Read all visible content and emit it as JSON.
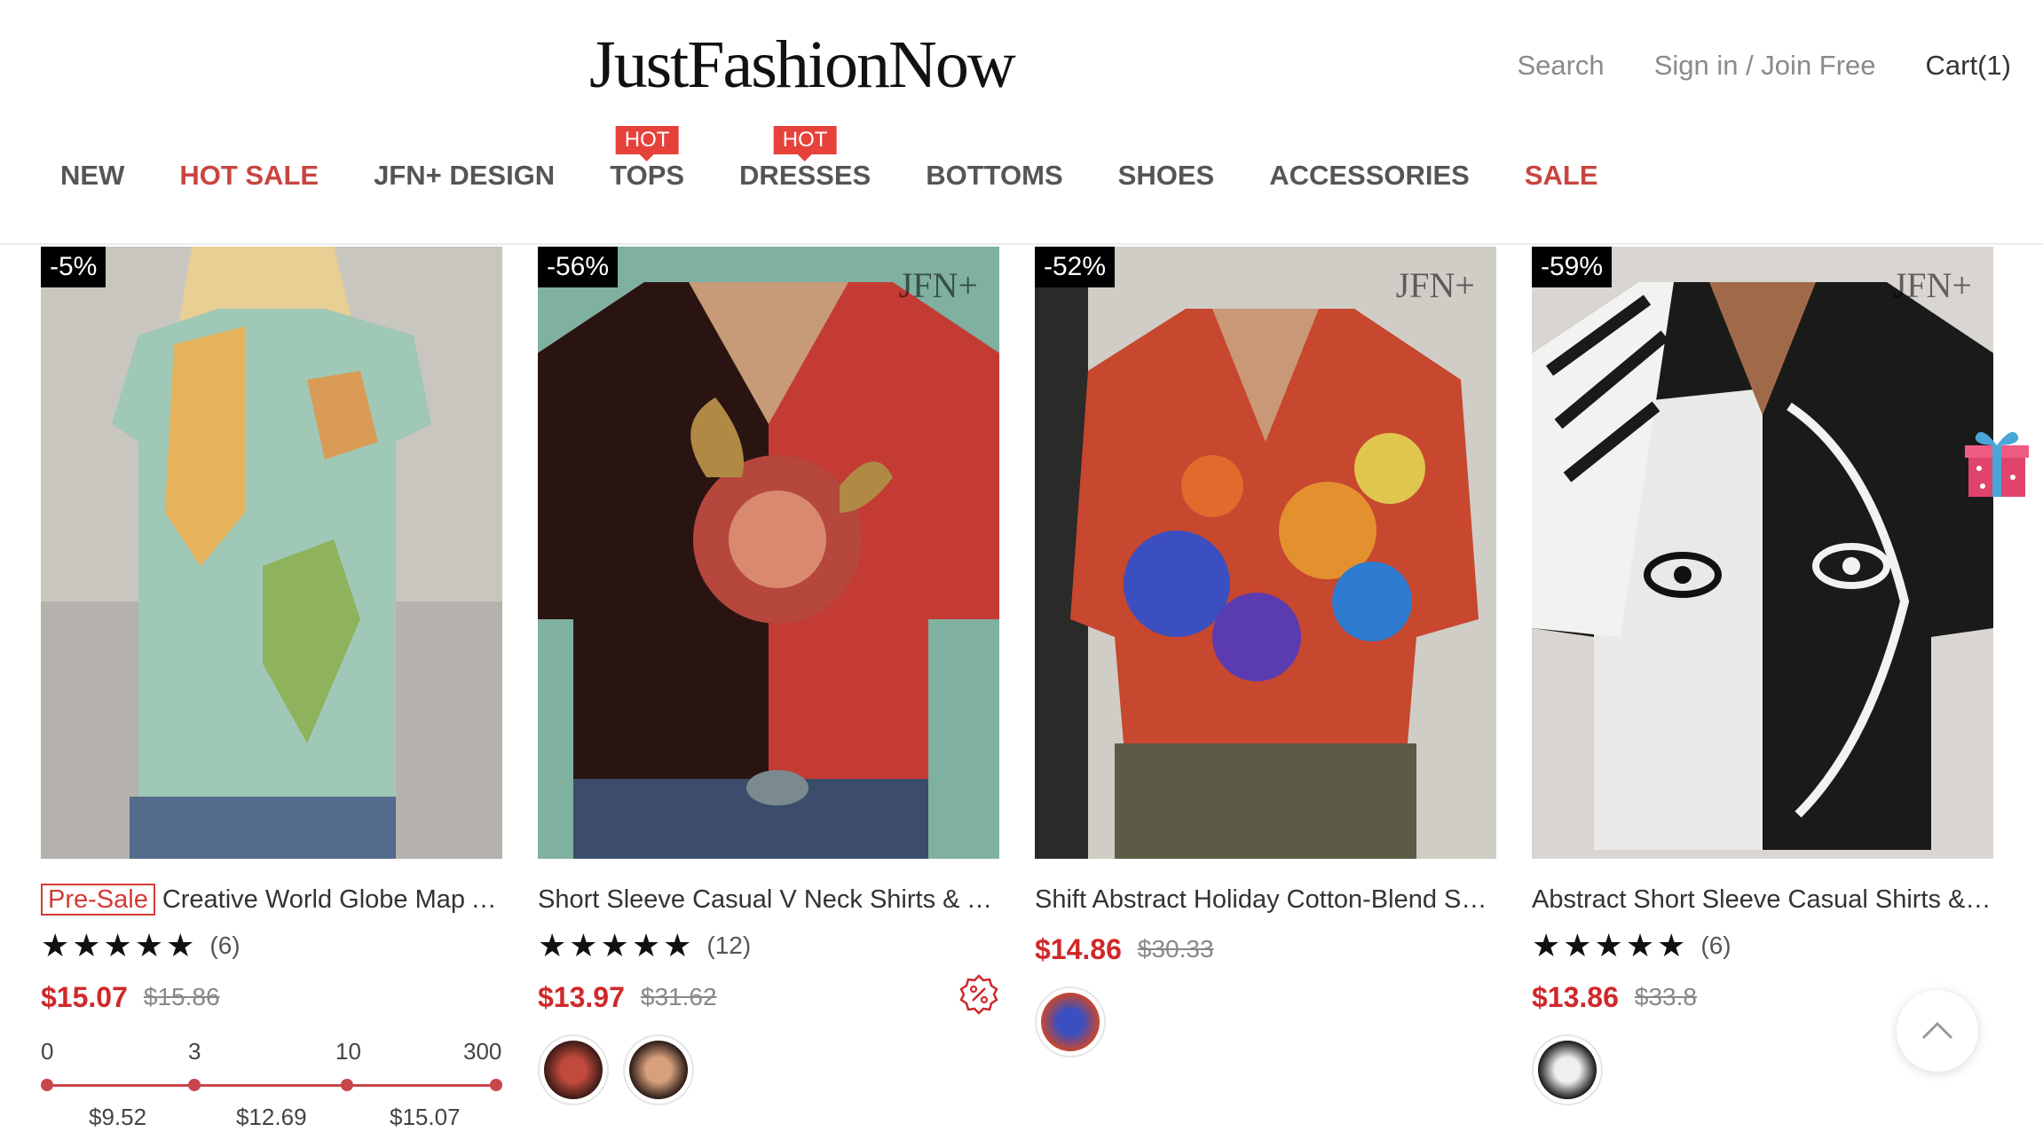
{
  "header": {
    "logo": "JustFashionNow",
    "search": "Search",
    "signin": "Sign in / Join Free",
    "cart": "Cart(1)"
  },
  "nav": [
    {
      "label": "NEW",
      "red": false,
      "hot": ""
    },
    {
      "label": "HOT SALE",
      "red": true,
      "hot": ""
    },
    {
      "label": "JFN+ DESIGN",
      "red": false,
      "hot": ""
    },
    {
      "label": "TOPS",
      "red": false,
      "hot": "HOT"
    },
    {
      "label": "DRESSES",
      "red": false,
      "hot": "HOT"
    },
    {
      "label": "BOTTOMS",
      "red": false,
      "hot": ""
    },
    {
      "label": "SHOES",
      "red": false,
      "hot": ""
    },
    {
      "label": "ACCESSORIES",
      "red": false,
      "hot": ""
    },
    {
      "label": "SALE",
      "red": true,
      "hot": ""
    }
  ],
  "products": [
    {
      "discount": "-5%",
      "jfn_mark": "",
      "presale": "Pre-Sale",
      "title": "Creative World Globe Map A...",
      "stars": "★★★★★",
      "reviews": "(6)",
      "price": "$15.07",
      "old_price": "$15.86",
      "tiers": {
        "qty": [
          "0",
          "3",
          "10",
          "300"
        ],
        "prices": [
          "$9.52",
          "$12.69",
          "$15.07"
        ]
      }
    },
    {
      "discount": "-56%",
      "jfn_mark": "JFN+",
      "presale": "",
      "title": "Short Sleeve Casual V Neck Shirts & Tops",
      "stars": "★★★★★",
      "reviews": "(12)",
      "price": "$13.97",
      "old_price": "$31.62"
    },
    {
      "discount": "-52%",
      "jfn_mark": "JFN+",
      "presale": "",
      "title": "Shift Abstract Holiday Cotton-Blend Shirt...",
      "stars": "",
      "reviews": "",
      "price": "$14.86",
      "old_price": "$30.33"
    },
    {
      "discount": "-59%",
      "jfn_mark": "JFN+",
      "presale": "",
      "title": "Abstract Short Sleeve Casual Shirts & Tops",
      "stars": "★★★★★",
      "reviews": "(6)",
      "price": "$13.86",
      "old_price": "$33.8"
    }
  ],
  "icons": {
    "promo": "percent-badge-icon",
    "scroll_top": "chevron-up-icon",
    "gift": "gift-icon"
  },
  "colors": {
    "accent_red": "#d0282a",
    "nav_red": "#c8453f",
    "hot_badge": "#e7423a"
  }
}
